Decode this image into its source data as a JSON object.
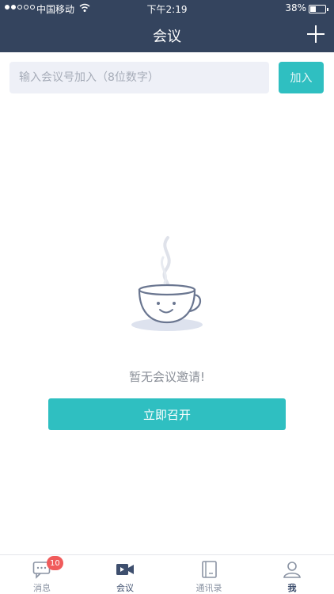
{
  "status_bar": {
    "carrier": "中国移动",
    "time": "下午2:19",
    "battery_percent": "38%",
    "battery_level": 0.38
  },
  "header": {
    "title": "会议",
    "add_icon": "plus-icon"
  },
  "join": {
    "placeholder": "输入会议号加入（8位数字）",
    "button_label": "加入"
  },
  "empty_state": {
    "icon": "coffee-cup-icon",
    "message": "暂无会议邀请!",
    "start_button_label": "立即召开"
  },
  "tabbar": {
    "items": [
      {
        "label": "消息",
        "icon": "chat-icon",
        "badge": "10"
      },
      {
        "label": "会议",
        "icon": "video-camera-icon",
        "active": true
      },
      {
        "label": "通讯录",
        "icon": "contacts-book-icon"
      },
      {
        "label": "我",
        "icon": "person-icon"
      }
    ]
  },
  "colors": {
    "header_bg": "#34445e",
    "accent": "#2fbfc1",
    "badge": "#f05b5b",
    "input_bg": "#eef0f7"
  }
}
